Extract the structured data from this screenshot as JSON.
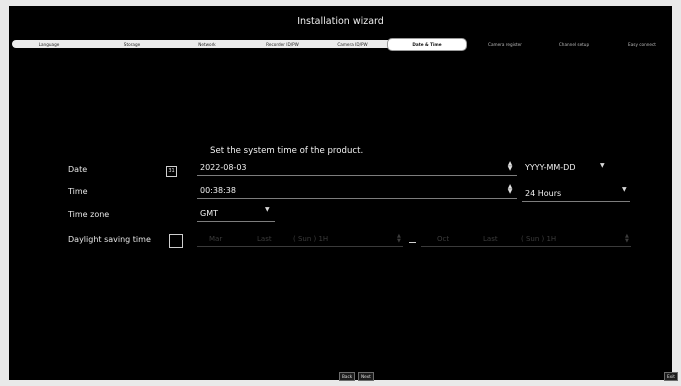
{
  "wizard": {
    "title": "Installation wizard"
  },
  "steps": [
    {
      "label": "Language",
      "state": "done"
    },
    {
      "label": "Storage",
      "state": "done"
    },
    {
      "label": "Network",
      "state": "done"
    },
    {
      "label": "Recorder ID/PW",
      "state": "done"
    },
    {
      "label": "Camera ID/PW",
      "state": "done"
    },
    {
      "label": "Date & Time",
      "state": "active"
    },
    {
      "label": "Camera register",
      "state": "todo"
    },
    {
      "label": "Channel setup",
      "state": "todo"
    },
    {
      "label": "Easy connect",
      "state": "todo"
    }
  ],
  "form": {
    "description": "Set the system time of the product.",
    "date": {
      "label": "Date",
      "value": "2022-08-03",
      "calendar_icon": "31",
      "format": "YYYY-MM-DD"
    },
    "time": {
      "label": "Time",
      "value": "00:38:38",
      "format": "24 Hours"
    },
    "timezone": {
      "label": "Time zone",
      "value": "GMT"
    },
    "dst": {
      "label": "Daylight saving time",
      "checked": false,
      "start": {
        "month": "Mar",
        "week": "Last",
        "day_time": "( Sun ) 1H"
      },
      "end": {
        "month": "Oct",
        "week": "Last",
        "day_time": "( Sun ) 1H"
      }
    }
  },
  "footer": {
    "back_label": "Back",
    "next_label": "Next",
    "exit_label": "Exit"
  },
  "icons": {
    "spinner_up": "▲",
    "spinner_down": "▼",
    "dropdown": "▼"
  }
}
